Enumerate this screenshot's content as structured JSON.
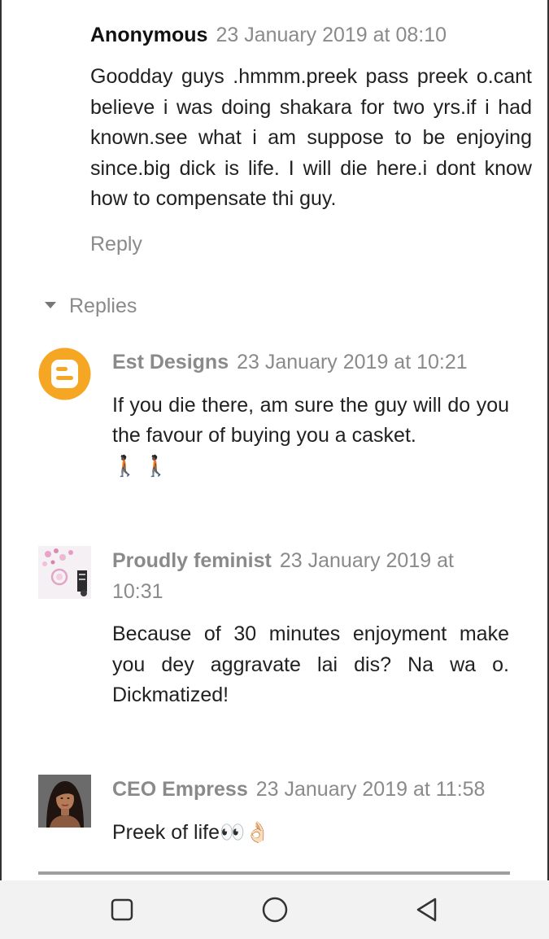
{
  "top_comment": {
    "author": "Anonymous",
    "timestamp": "23 January 2019 at 08:10",
    "text": "Goodday guys .hmmm.preek pass preek o.cant believe i was doing shakara for two yrs.if i had known.see what i am suppose to be enjoying since.big dick is life. I will die here.i dont know how to compensate thi guy.",
    "reply_label": "Reply"
  },
  "replies_toggle_label": "Replies",
  "replies": [
    {
      "author": "Est Designs",
      "timestamp": "23 January 2019 at 10:21",
      "text": "If you die there, am sure the guy will do you the favour of buying you a casket.",
      "emoji": "🚶🏿 🚶🏿",
      "avatar": "blogger-icon"
    },
    {
      "author": "Proudly feminist",
      "timestamp": "23 January 2019 at 10:31",
      "text": "Because of 30 minutes enjoyment make you dey aggravate lai dis? Na wa o. Dickmatized!",
      "avatar": "profile-photo"
    },
    {
      "author": "CEO Empress",
      "timestamp": "23 January 2019 at 11:58",
      "text": "Preek of life",
      "emoji": "👀👌🏻",
      "avatar": "profile-photo"
    }
  ],
  "nav_bar": {
    "buttons": [
      "recents-icon",
      "home-icon",
      "back-icon"
    ]
  },
  "colors": {
    "blogger_orange": "#f5a623",
    "muted_text": "#8a8a8a",
    "body_text": "#212121"
  }
}
